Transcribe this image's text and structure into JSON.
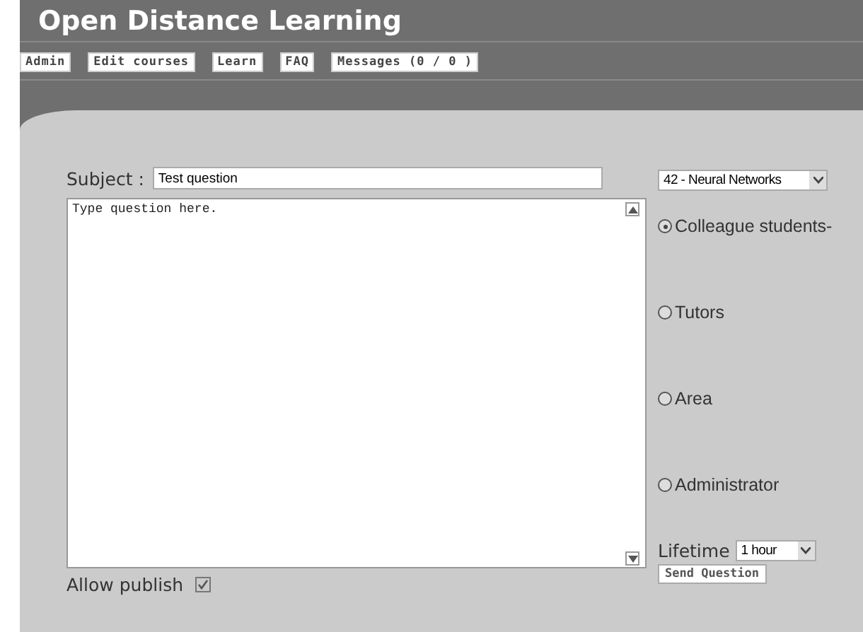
{
  "site": {
    "title": "Open Distance Learning"
  },
  "nav": [
    {
      "label": "Admin"
    },
    {
      "label": "Edit courses"
    },
    {
      "label": "Learn"
    },
    {
      "label": "FAQ"
    },
    {
      "label": "Messages (0 / 0 )"
    }
  ],
  "form": {
    "subject_label": "Subject :",
    "subject_value": "Test question",
    "course": "42 - Neural Networks",
    "question_placeholder": "Type question here.",
    "recipients": [
      {
        "label": "Colleague students-",
        "selected": true
      },
      {
        "label": "Tutors",
        "selected": false
      },
      {
        "label": "Area",
        "selected": false
      },
      {
        "label": "Administrator",
        "selected": false
      }
    ],
    "allow_publish": {
      "label": "Allow publish",
      "checked": true
    },
    "lifetime_label": "Lifetime",
    "lifetime": "1 hour",
    "send": "Send Question"
  }
}
